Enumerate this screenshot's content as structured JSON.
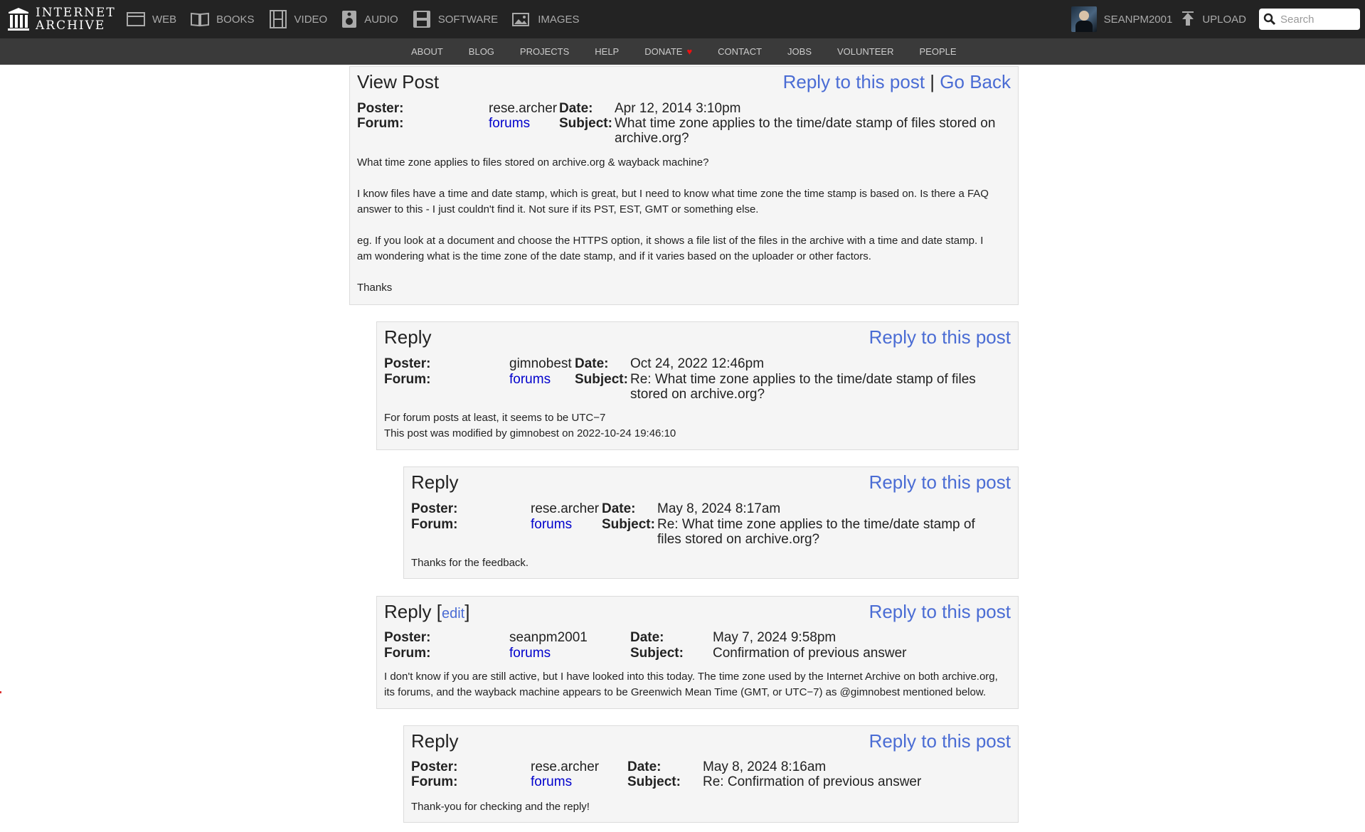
{
  "header": {
    "logo_line1": "INTERNET",
    "logo_line2": "ARCHIVE",
    "media": [
      "WEB",
      "BOOKS",
      "VIDEO",
      "AUDIO",
      "SOFTWARE",
      "IMAGES"
    ],
    "username": "SEANPM2001",
    "upload_label": "UPLOAD",
    "search_placeholder": "Search"
  },
  "subnav": {
    "items": [
      "ABOUT",
      "BLOG",
      "PROJECTS",
      "HELP",
      "DONATE",
      "CONTACT",
      "JOBS",
      "VOLUNTEER",
      "PEOPLE"
    ],
    "donate_heart": "♥"
  },
  "labels": {
    "poster": "Poster:",
    "forum": "Forum:",
    "date": "Date:",
    "subject": "Subject:",
    "reply_to_post": "Reply to this post",
    "go_back": "Go Back",
    "sep": "|",
    "edit": "edit"
  },
  "posts": [
    {
      "title": "View Post",
      "poster": "rese.archer",
      "forum": "forums",
      "date": "Apr 12, 2014 3:10pm",
      "subject_line1": "What time zone applies to the time/date stamp of files stored on",
      "subject_line2": "archive.org?",
      "body": [
        "What time zone applies to files stored on archive.org & wayback machine?",
        "I know files have a time and date stamp, which is great, but I need to know what time zone the time stamp is based on. Is there a FAQ",
        "answer to this - I just couldn't find it. Not sure if its PST, EST, GMT or something else.",
        "eg. If you look at a document and choose the HTTPS option, it shows a file list of the files in the archive with a time and date stamp. I",
        "am wondering what is the time zone of the date stamp, and if it varies based on the uploader or other factors.",
        "Thanks"
      ]
    },
    {
      "title": "Reply",
      "poster": "gimnobest",
      "forum": "forums",
      "date": "Oct 24, 2022 12:46pm",
      "subject_line1": "Re: What time zone applies to the time/date stamp of files",
      "subject_line2": "stored on archive.org?",
      "body": [
        "For forum posts at least, it seems to be UTC−7",
        "This post was modified by gimnobest on 2022-10-24 19:46:10"
      ]
    },
    {
      "title": "Reply",
      "poster": "rese.archer",
      "forum": "forums",
      "date": "May 8, 2024 8:17am",
      "subject_line1": "Re: What time zone applies to the time/date stamp of",
      "subject_line2": "files stored on archive.org?",
      "body": [
        "Thanks for the feedback."
      ]
    },
    {
      "title": "Reply",
      "poster": "seanpm2001",
      "forum": "forums",
      "date": "May 7, 2024 9:58pm",
      "subject_line1": "Confirmation of previous answer",
      "body": [
        "I don't know if you are still active, but I have looked into this today. The time zone used by the Internet Archive on both archive.org,",
        "its forums, and the wayback machine appears to be Greenwich Mean Time (GMT, or UTC−7) as @gimnobest mentioned below."
      ]
    },
    {
      "title": "Reply",
      "poster": "rese.archer",
      "forum": "forums",
      "date": "May 8, 2024 8:16am",
      "subject_line1": "Re: Confirmation of previous answer",
      "body": [
        "Thank-you for checking and the reply!"
      ]
    }
  ]
}
